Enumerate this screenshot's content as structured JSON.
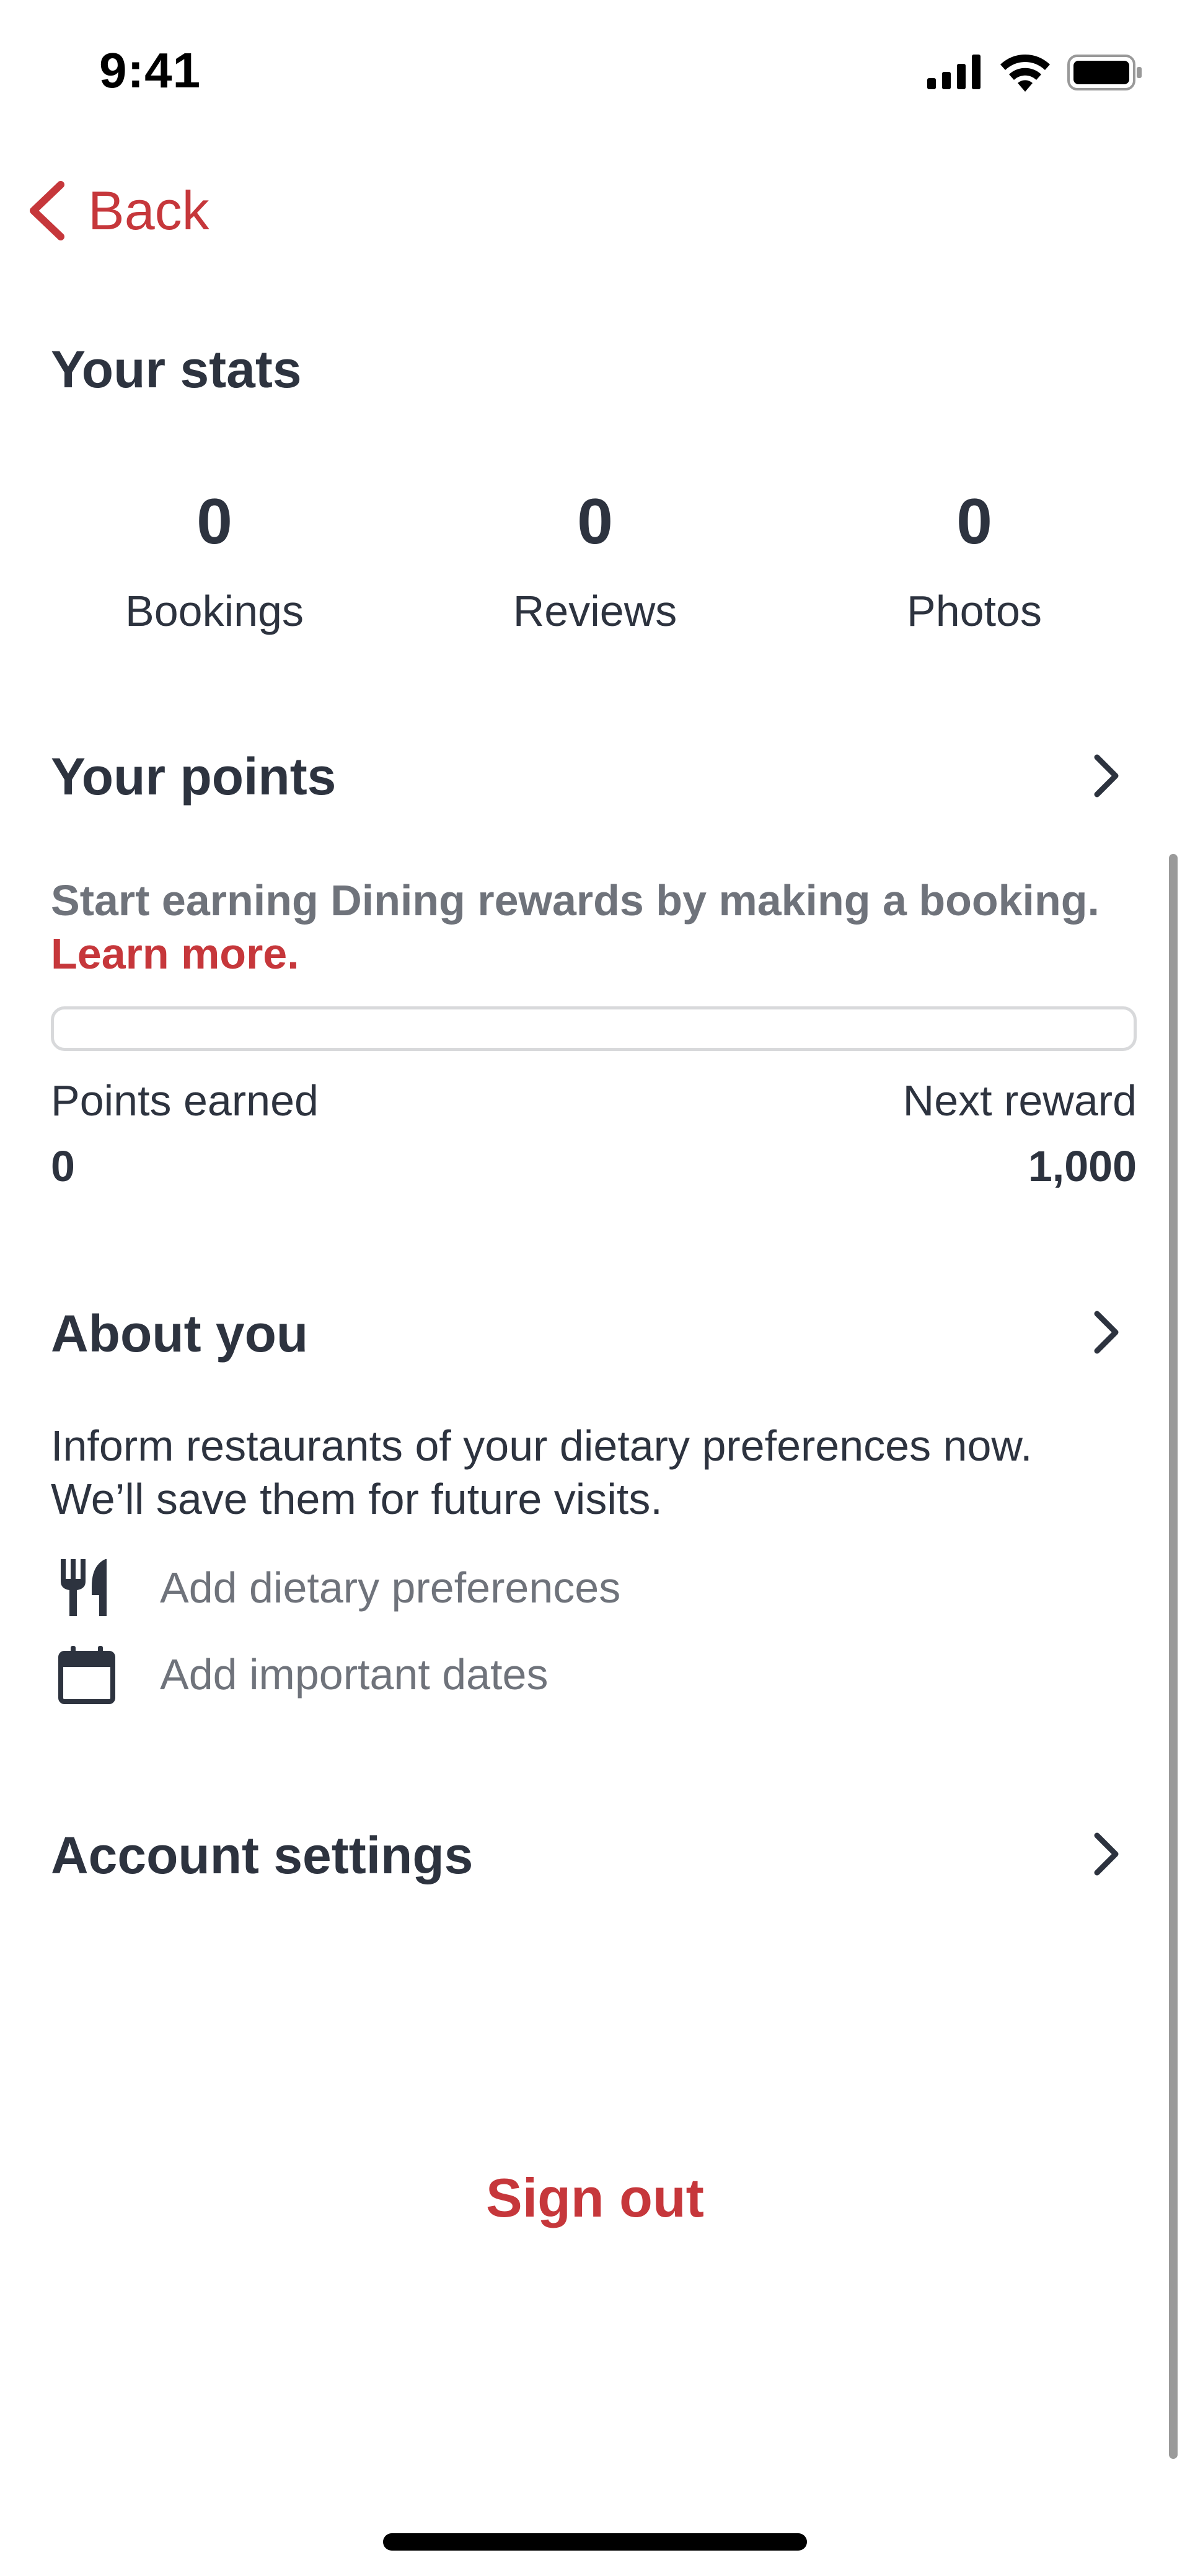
{
  "status_bar": {
    "time": "9:41",
    "icons": [
      "cellular-signal-icon",
      "wifi-icon",
      "battery-icon"
    ]
  },
  "nav": {
    "back_label": "Back",
    "back_icon": "chevron-left-icon"
  },
  "stats": {
    "title": "Your stats",
    "items": [
      {
        "value": "0",
        "label": "Bookings"
      },
      {
        "value": "0",
        "label": "Reviews"
      },
      {
        "value": "0",
        "label": "Photos"
      }
    ]
  },
  "points": {
    "title": "Your points",
    "description": "Start earning Dining rewards by making a booking.",
    "learn_more": "Learn more.",
    "progress_fraction": 0,
    "earned_label": "Points earned",
    "earned_value": "0",
    "next_label": "Next reward",
    "next_value": "1,000"
  },
  "about": {
    "title": "About you",
    "description_line1": "Inform restaurants of your dietary preferences now.",
    "description_line2": "We’ll save them for future visits.",
    "items": [
      {
        "label": "Add dietary preferences",
        "icon": "fork-knife-icon"
      },
      {
        "label": "Add important dates",
        "icon": "calendar-icon"
      }
    ]
  },
  "account": {
    "title": "Account settings"
  },
  "sign_out_label": "Sign out",
  "colors": {
    "accent": "#c6373b",
    "text_primary": "#2d333f",
    "text_secondary": "#6f737b",
    "progress_border": "#d8d9db"
  }
}
